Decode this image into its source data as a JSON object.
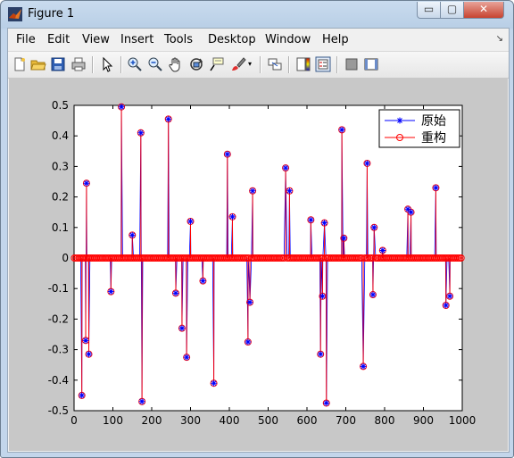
{
  "window": {
    "title": "Figure 1",
    "controls": {
      "minimize": "▭",
      "maximize": "▢",
      "close": "✕"
    }
  },
  "menu": [
    "File",
    "Edit",
    "View",
    "Insert",
    "Tools",
    "Desktop",
    "Window",
    "Help"
  ],
  "toolbar_icons": [
    "new-figure-icon",
    "open-file-icon",
    "save-icon",
    "print-icon",
    "pointer-icon",
    "zoom-in-icon",
    "zoom-out-icon",
    "pan-hand-icon",
    "rotate-3d-icon",
    "data-cursor-icon",
    "brush-icon",
    "brush-dropdown-icon",
    "link-plot-icon",
    "colorbar-icon",
    "legend-icon",
    "hide-plot-tools-icon",
    "show-plot-tools-icon"
  ],
  "colors": {
    "original": "#0000ff",
    "reconstructed": "#ff0000",
    "axes_bg": "#ffffff",
    "figure_bg": "#c8c8c8"
  },
  "chart_data": {
    "type": "stem",
    "title": "",
    "xlabel": "",
    "ylabel": "",
    "xlim": [
      0,
      1000
    ],
    "ylim": [
      -0.5,
      0.5
    ],
    "xticks": [
      "0",
      "100",
      "200",
      "300",
      "400",
      "500",
      "600",
      "700",
      "800",
      "900",
      "1000"
    ],
    "yticks": [
      "0.5",
      "0.4",
      "0.3",
      "0.2",
      "0.1",
      "0",
      "-0.1",
      "-0.2",
      "-0.3",
      "-0.4",
      "-0.5"
    ],
    "legend_position": "top-right",
    "series": [
      {
        "name": "原始",
        "marker": "*",
        "style": "line-with-star",
        "color": "#0000ff"
      },
      {
        "name": "重构",
        "marker": "o",
        "style": "stem-circle",
        "color": "#ff0000"
      }
    ],
    "nonzero": [
      [
        20,
        -0.45
      ],
      [
        30,
        -0.27
      ],
      [
        32,
        0.245
      ],
      [
        38,
        -0.315
      ],
      [
        95,
        -0.11
      ],
      [
        122,
        0.495
      ],
      [
        150,
        0.075
      ],
      [
        172,
        0.41
      ],
      [
        175,
        -0.47
      ],
      [
        243,
        0.455
      ],
      [
        262,
        -0.115
      ],
      [
        278,
        -0.23
      ],
      [
        290,
        -0.325
      ],
      [
        300,
        0.12
      ],
      [
        332,
        -0.075
      ],
      [
        360,
        -0.41
      ],
      [
        395,
        0.34
      ],
      [
        408,
        0.135
      ],
      [
        448,
        -0.275
      ],
      [
        453,
        -0.145
      ],
      [
        460,
        0.22
      ],
      [
        545,
        0.295
      ],
      [
        555,
        0.22
      ],
      [
        610,
        0.125
      ],
      [
        635,
        -0.315
      ],
      [
        640,
        -0.125
      ],
      [
        645,
        0.115
      ],
      [
        650,
        -0.475
      ],
      [
        690,
        0.42
      ],
      [
        695,
        0.065
      ],
      [
        745,
        -0.355
      ],
      [
        755,
        0.31
      ],
      [
        770,
        -0.12
      ],
      [
        773,
        0.1
      ],
      [
        795,
        0.025
      ],
      [
        860,
        0.16
      ],
      [
        868,
        0.15
      ],
      [
        932,
        0.23
      ],
      [
        958,
        -0.155
      ],
      [
        968,
        -0.125
      ]
    ],
    "zero_samples": {
      "from": 1,
      "to": 1000,
      "step": 4,
      "value": 0
    }
  }
}
